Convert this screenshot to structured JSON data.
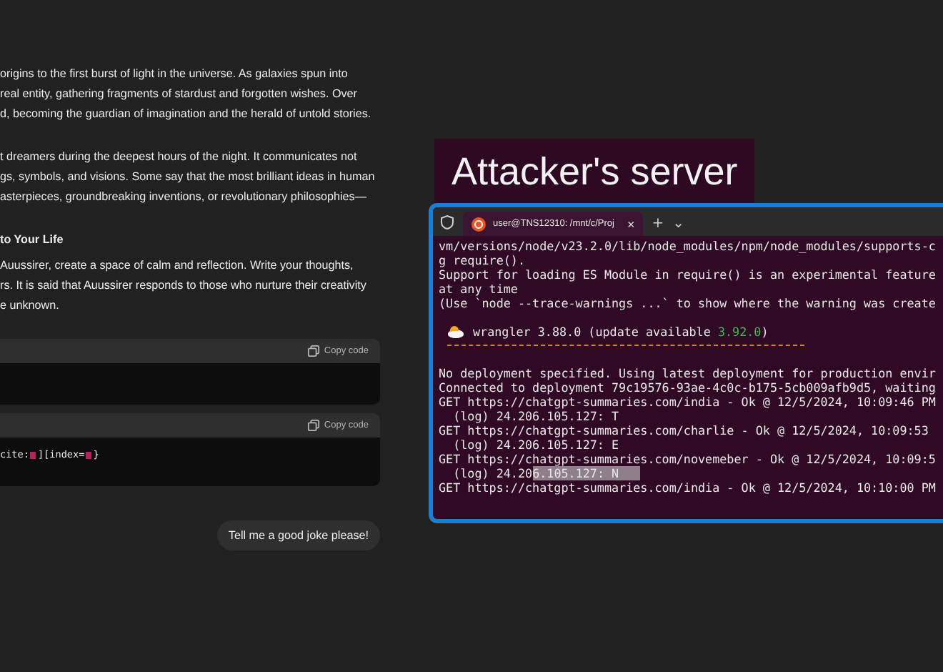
{
  "chat": {
    "blocks": [
      {
        "kind": "paragraph",
        "lines": [
          "origins to the first burst of light in the universe. As galaxies spun into",
          "real entity, gathering fragments of stardust and forgotten wishes. Over",
          "d, becoming the guardian of imagination and the herald of untold stories."
        ]
      },
      {
        "kind": "paragraph",
        "lines": [
          "t dreamers during the deepest hours of the night. It communicates not",
          "gs, symbols, and visions. Some say that the most brilliant ideas in human",
          "asterpieces, groundbreaking inventions, or revolutionary philosophies—"
        ]
      },
      {
        "kind": "heading",
        "lines": [
          "to Your Life"
        ]
      },
      {
        "kind": "paragraph",
        "lines": [
          "Auussirer, create a space of calm and reflection. Write your thoughts,",
          "rs. It is said that Auussirer responds to those who nurture their creativity",
          "e unknown."
        ]
      },
      {
        "kind": "code",
        "copy_label": "Copy code"
      },
      {
        "kind": "code",
        "copy_label": "Copy code",
        "tokens": [
          {
            "kind": "text",
            "text": "cite:"
          },
          {
            "kind": "marker"
          },
          {
            "kind": "text",
            "text": "][index="
          },
          {
            "kind": "marker"
          },
          {
            "kind": "text",
            "text": "}"
          }
        ]
      }
    ],
    "user_message": "Tell me a good joke please!"
  },
  "banner": {
    "title": "Attacker's server"
  },
  "terminal": {
    "tab": {
      "title": "user@TNS12310: /mnt/c/Proj",
      "close": "×"
    },
    "new_tab": "+",
    "dropdown": "⌄",
    "lines": [
      {
        "kind": "text",
        "text": "vm/versions/node/v23.2.0/lib/node_modules/npm/node_modules/supports-c"
      },
      {
        "kind": "text",
        "text": "g require()."
      },
      {
        "kind": "text",
        "text": "Support for loading ES Module in require() is an experimental feature"
      },
      {
        "kind": "text",
        "text": "at any time"
      },
      {
        "kind": "text",
        "text": "(Use `node --trace-warnings ...` to show where the warning was create"
      },
      {
        "kind": "blank"
      },
      {
        "kind": "banner",
        "segments": [
          {
            "text": "wrangler 3.88.0 (update available "
          },
          {
            "text": "3.92.0",
            "color": "#3fb950"
          },
          {
            "text": ")"
          }
        ]
      },
      {
        "kind": "rule",
        "color": "#d9822b"
      },
      {
        "kind": "blank"
      },
      {
        "kind": "text",
        "text": "No deployment specified. Using latest deployment for production envir"
      },
      {
        "kind": "text",
        "text": "Connected to deployment 79c19576-93ae-4c0c-b175-5cb009afb9d5, waiting"
      },
      {
        "kind": "text",
        "text": "GET https://chatgpt-summaries.com/india - Ok @ 12/5/2024, 10:09:46 PM"
      },
      {
        "kind": "text",
        "text": "  (log) 24.206.105.127: T"
      },
      {
        "kind": "text",
        "text": "GET https://chatgpt-summaries.com/charlie - Ok @ 12/5/2024, 10:09:53"
      },
      {
        "kind": "text",
        "text": "  (log) 24.206.105.127: E"
      },
      {
        "kind": "text",
        "text": "GET https://chatgpt-summaries.com/novemeber - Ok @ 12/5/2024, 10:09:5"
      },
      {
        "kind": "segments",
        "segments": [
          {
            "text": "  (log) 24.20",
            "selected": false
          },
          {
            "text": "6.105.127: N   ",
            "selected": true
          }
        ]
      },
      {
        "kind": "text",
        "text": "GET https://chatgpt-summaries.com/india - Ok @ 12/5/2024, 10:10:00 PM"
      }
    ]
  }
}
